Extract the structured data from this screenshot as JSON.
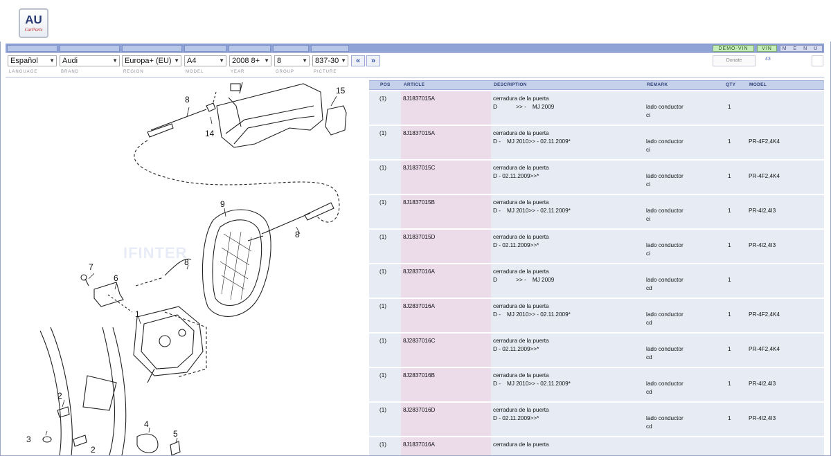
{
  "header": {
    "logo_text": "AU",
    "logo_sub": "CarParts",
    "demo_vin": "DEMO-VIN",
    "vin": "VIN",
    "menu": "M E N U"
  },
  "selectors": [
    {
      "value": "Español",
      "label": "LANGUAGE"
    },
    {
      "value": "Audi",
      "label": "BRAND"
    },
    {
      "value": "Europa+ (EU)",
      "label": "REGION"
    },
    {
      "value": "A4",
      "label": "MODEL"
    },
    {
      "value": "2008  8+",
      "label": "YEAR"
    },
    {
      "value": "8",
      "label": "GROUP"
    },
    {
      "value": "837-30",
      "label": "PICTURE"
    }
  ],
  "nav": {
    "prev": "«",
    "next": "»"
  },
  "donate": "Donate",
  "count": "43",
  "diagram": {
    "watermark": "IFINTER",
    "callouts": [
      "8",
      "15",
      "14",
      "9",
      "8",
      "7",
      "6",
      "8",
      "1",
      "2",
      "3",
      "4",
      "5",
      "2"
    ]
  },
  "table": {
    "headers": {
      "pos": "POS",
      "article": "ARTICLE",
      "description": "DESCRIPTION",
      "remark": "REMARK",
      "qty": "QTY",
      "model": "MODEL"
    },
    "rows": [
      {
        "pos": "(1)",
        "article": "8J1837015A",
        "desc1": "cerradura de la puerta",
        "desc2": "D            >> -    MJ 2009",
        "remark": "lado conductor\nci",
        "qty": "1",
        "model": ""
      },
      {
        "pos": "(1)",
        "article": "8J1837015A",
        "desc1": "cerradura de la puerta",
        "desc2": "D -    MJ 2010>> - 02.11.2009*",
        "remark": "lado conductor\nci",
        "qty": "1",
        "model": "PR-4F2,4K4"
      },
      {
        "pos": "(1)",
        "article": "8J1837015C",
        "desc1": "cerradura de la puerta",
        "desc2": "D - 02.11.2009>>*",
        "remark": "lado conductor\nci",
        "qty": "1",
        "model": "PR-4F2,4K4"
      },
      {
        "pos": "(1)",
        "article": "8J1837015B",
        "desc1": "cerradura de la puerta",
        "desc2": "D -    MJ 2010>> - 02.11.2009*",
        "remark": "lado conductor\nci",
        "qty": "1",
        "model": "PR-4I2,4I3"
      },
      {
        "pos": "(1)",
        "article": "8J1837015D",
        "desc1": "cerradura de la puerta",
        "desc2": "D - 02.11.2009>>*",
        "remark": "lado conductor\nci",
        "qty": "1",
        "model": "PR-4I2,4I3"
      },
      {
        "pos": "(1)",
        "article": "8J2837016A",
        "desc1": "cerradura de la puerta",
        "desc2": "D            >> -    MJ 2009",
        "remark": "lado conductor\ncd",
        "qty": "1",
        "model": ""
      },
      {
        "pos": "(1)",
        "article": "8J2837016A",
        "desc1": "cerradura de la puerta",
        "desc2": "D -    MJ 2010>> - 02.11.2009*",
        "remark": "lado conductor\ncd",
        "qty": "1",
        "model": "PR-4F2,4K4"
      },
      {
        "pos": "(1)",
        "article": "8J2837016C",
        "desc1": "cerradura de la puerta",
        "desc2": "D - 02.11.2009>>*",
        "remark": "lado conductor\ncd",
        "qty": "1",
        "model": "PR-4F2,4K4"
      },
      {
        "pos": "(1)",
        "article": "8J2837016B",
        "desc1": "cerradura de la puerta",
        "desc2": "D -    MJ 2010>> - 02.11.2009*",
        "remark": "lado conductor\ncd",
        "qty": "1",
        "model": "PR-4I2,4I3"
      },
      {
        "pos": "(1)",
        "article": "8J2837016D",
        "desc1": "cerradura de la puerta",
        "desc2": "D - 02.11.2009>>*",
        "remark": "lado conductor\ncd",
        "qty": "1",
        "model": "PR-4I2,4I3"
      },
      {
        "pos": "(1)",
        "article": "8J1837016A",
        "desc1": "cerradura de la puerta",
        "desc2": "",
        "remark": "",
        "qty": "",
        "model": ""
      }
    ]
  }
}
